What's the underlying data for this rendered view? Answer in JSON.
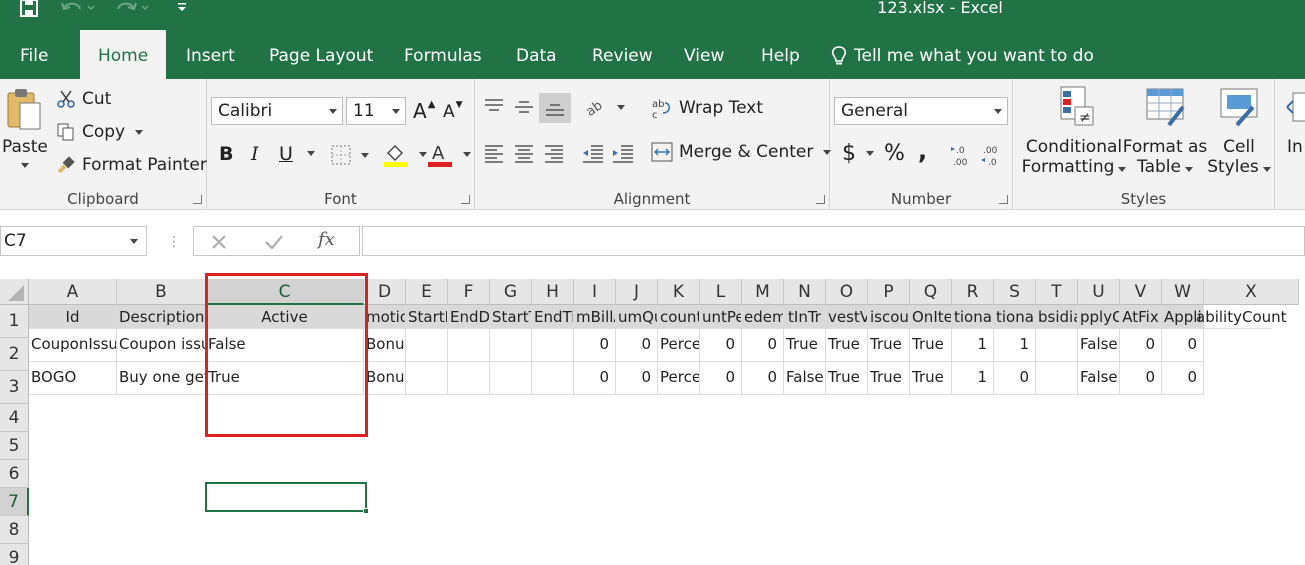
{
  "window": {
    "title": "123.xlsx  -  Excel"
  },
  "tabs": [
    "File",
    "Home",
    "Insert",
    "Page Layout",
    "Formulas",
    "Data",
    "Review",
    "View",
    "Help"
  ],
  "tell_me": "Tell me what you want to do",
  "ribbon": {
    "clipboard": {
      "label": "Clipboard",
      "paste": "Paste",
      "cut": "Cut",
      "copy": "Copy",
      "format_painter": "Format Painter"
    },
    "font": {
      "label": "Font",
      "name": "Calibri",
      "size": "11",
      "bold": "B",
      "italic": "I",
      "underline": "U"
    },
    "alignment": {
      "label": "Alignment",
      "wrap_text": "Wrap Text",
      "merge_center": "Merge & Center"
    },
    "number": {
      "label": "Number",
      "format": "General",
      "currency": "$",
      "percent": "%",
      "comma": ","
    },
    "styles": {
      "label": "Styles",
      "conditional_line1": "Conditional",
      "conditional_line2": "Formatting",
      "table_line1": "Format as",
      "table_line2": "Table",
      "cell_line1": "Cell",
      "cell_line2": "Styles"
    },
    "insert_partial": "In"
  },
  "formula_bar": {
    "name_box": "C7",
    "fx": "fx",
    "value": ""
  },
  "columns": [
    "A",
    "B",
    "C",
    "D",
    "E",
    "F",
    "G",
    "H",
    "I",
    "J",
    "K",
    "L",
    "M",
    "N",
    "O",
    "P",
    "Q",
    "R",
    "S",
    "T",
    "U",
    "V",
    "W",
    "X"
  ],
  "rows": [
    "1",
    "2",
    "3",
    "4",
    "5",
    "6",
    "7",
    "8",
    "9"
  ],
  "header_row": [
    "Id",
    "Description",
    "Active",
    "motion",
    "StartDa",
    "EndDat",
    "StartTim",
    "EndTim",
    "mBillA",
    "umQu",
    "countT",
    "untPe",
    "edemat",
    "tInTr",
    "vestVa",
    "iscoun",
    "OnIte",
    "tional",
    "tionab",
    "bsidia",
    "pplyO",
    "AtFix",
    "Applica",
    "abilityCount"
  ],
  "data_rows": [
    [
      "CouponIssu",
      "Coupon issu",
      "False",
      "BonusBuys",
      "",
      "",
      "",
      "",
      "0",
      "0",
      "Perce",
      "0",
      "0",
      "True",
      "True",
      "True",
      "True",
      "1",
      "1",
      "",
      "False",
      "0",
      "0",
      ""
    ],
    [
      "BOGO",
      "Buy one get",
      "True",
      "BonusBuys",
      "",
      "",
      "",
      "",
      "0",
      "0",
      "Perce",
      "0",
      "0",
      "False",
      "True",
      "True",
      "True",
      "1",
      "0",
      "",
      "False",
      "0",
      "0",
      ""
    ]
  ],
  "selected_cell": "C7"
}
